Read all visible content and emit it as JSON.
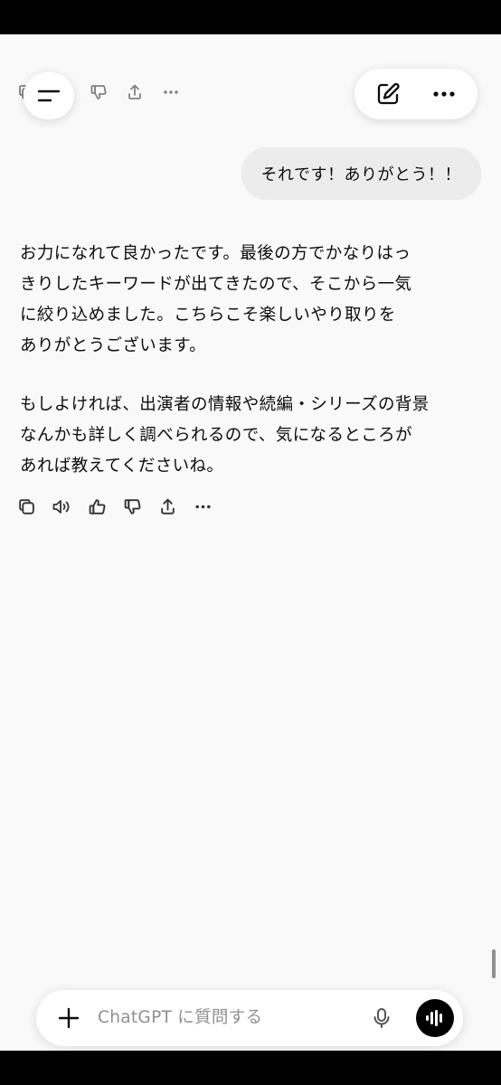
{
  "header": {
    "menu_icon": "menu-icon",
    "new_chat_icon": "new-chat-icon",
    "more_icon": "more-options-icon"
  },
  "top_actions": [
    "copy-icon",
    "thumbs-up-icon",
    "thumbs-down-icon",
    "share-icon",
    "more-options-icon"
  ],
  "conversation": {
    "user_message": "それです！ありがとう！！",
    "assistant_paragraphs": [
      {
        "lines": [
          "お力になれて良かったです。最後の方でかなりはっ",
          "きりしたキーワードが出てきたので、そこから一気",
          "に絞り込めました。こちらこそ楽しいやり取りを",
          "ありがとうございます。"
        ]
      },
      {
        "lines": [
          "もしよければ、出演者の情報や続編・シリーズの背景",
          "なんかも詳しく調べられるので、気になるところが",
          "あれば教えてくださいね。"
        ]
      }
    ],
    "message_actions": [
      "copy-icon",
      "read-aloud-icon",
      "thumbs-up-icon",
      "thumbs-down-icon",
      "share-icon",
      "more-options-icon"
    ]
  },
  "composer": {
    "placeholder": "ChatGPT に質問する",
    "plus_icon": "plus-icon",
    "mic_icon": "microphone-icon",
    "voice_icon": "voice-mode-icon"
  }
}
